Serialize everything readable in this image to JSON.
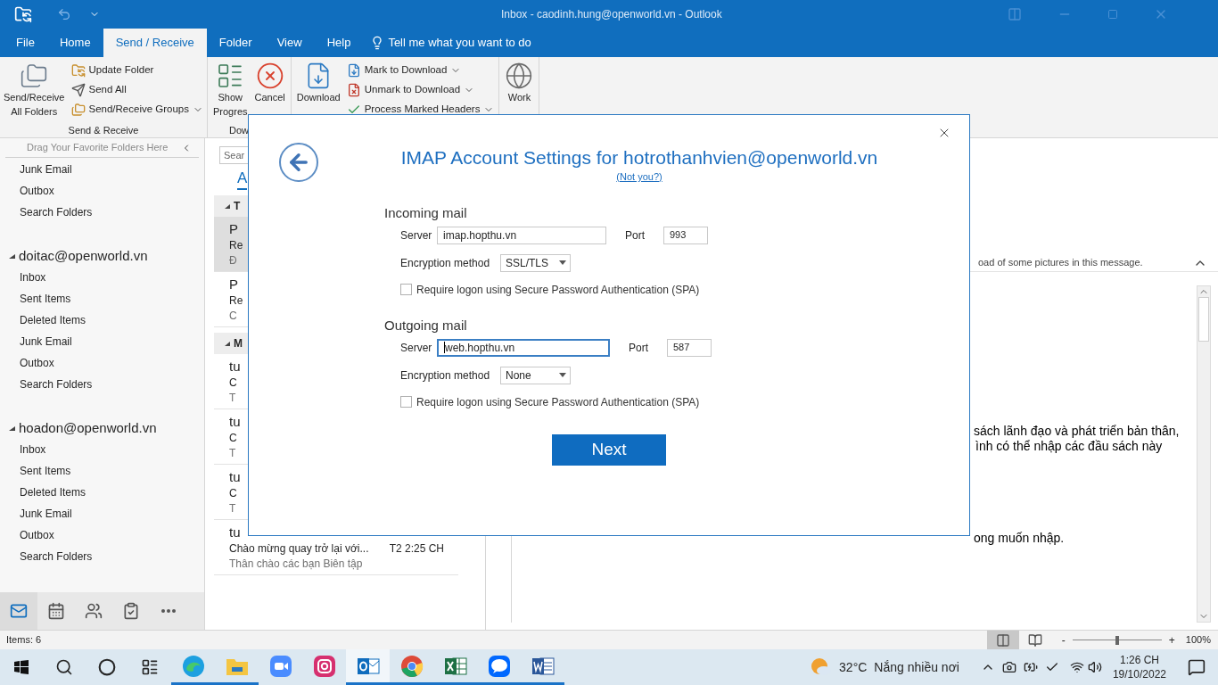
{
  "window": {
    "title": "Inbox - caodinh.hung@openworld.vn - Outlook"
  },
  "ribbon_tabs": [
    {
      "label": "File",
      "selected": false
    },
    {
      "label": "Home",
      "selected": false
    },
    {
      "label": "Send / Receive",
      "selected": true
    },
    {
      "label": "Folder",
      "selected": false
    },
    {
      "label": "View",
      "selected": false
    },
    {
      "label": "Help",
      "selected": false
    }
  ],
  "tell_me": "Tell me what you want to do",
  "ribbon_groups": [
    {
      "label": "Send & Receive",
      "large": [
        {
          "lines": [
            "Send/Receive",
            "All Folders"
          ],
          "kind": "sendreceive"
        }
      ],
      "small": [
        {
          "label": "Update Folder",
          "dropdown": false,
          "kind": "update"
        },
        {
          "label": "Send All",
          "dropdown": false,
          "kind": "sendall"
        },
        {
          "label": "Send/Receive Groups",
          "dropdown": true,
          "kind": "groups"
        }
      ]
    },
    {
      "label": "Dow",
      "large": [
        {
          "lines": [
            "Show",
            "Progres"
          ],
          "kind": "progress"
        },
        {
          "lines": [
            "Cancel"
          ],
          "kind": "cancel"
        }
      ]
    },
    {
      "large": [
        {
          "lines": [
            "Download"
          ],
          "kind": "download"
        }
      ],
      "small": [
        {
          "label": "Mark to Download",
          "dropdown": true,
          "kind": "mark"
        },
        {
          "label": "Unmark to Download",
          "dropdown": true,
          "kind": "unmark"
        },
        {
          "label": "Process Marked Headers",
          "dropdown": true,
          "kind": "process"
        }
      ]
    },
    {
      "large": [
        {
          "lines": [
            "Work"
          ],
          "kind": "offline"
        }
      ]
    }
  ],
  "folder_pane": {
    "favorites_hint": "Drag Your Favorite Folders Here",
    "top_folders": [
      "Junk Email",
      "Outbox",
      "Search Folders"
    ],
    "accounts": [
      {
        "name": "doitac@openworld.vn",
        "expanded": true,
        "folders": [
          "Inbox",
          "Sent Items",
          "Deleted Items",
          "Junk Email",
          "Outbox",
          "Search Folders"
        ]
      },
      {
        "name": "hoadon@openworld.vn",
        "expanded": true,
        "folders": [
          "Inbox",
          "Sent Items",
          "Deleted Items",
          "Junk Email",
          "Outbox",
          "Search Folders"
        ]
      }
    ],
    "nav": [
      {
        "kind": "mail",
        "selected": true
      },
      {
        "kind": "calendar",
        "selected": false
      },
      {
        "kind": "people",
        "selected": false
      },
      {
        "kind": "tasks",
        "selected": false
      },
      {
        "kind": "more",
        "selected": false
      }
    ]
  },
  "message_list": {
    "search": "Sear",
    "tab": "A",
    "groups": [
      {
        "label": "T",
        "items": [
          {
            "sender": "P",
            "subject": "Re",
            "preview": "Đ",
            "selected": true
          },
          {
            "sender": "P",
            "subject": "Re",
            "preview": "C",
            "selected": false
          }
        ]
      },
      {
        "label": "M",
        "items": [
          {
            "sender": "tu",
            "subject": "C",
            "preview": "T",
            "selected": false
          },
          {
            "sender": "tu",
            "subject": "C",
            "preview": "T",
            "selected": false
          },
          {
            "sender": "tu",
            "subject": "C",
            "preview": "T",
            "selected": false
          },
          {
            "sender": "tu",
            "subject": "Chào mừng quay trở lại với...",
            "preview": "Thân chào các bạn Biên tập",
            "time": "T2 2:25 CH",
            "selected": false
          }
        ]
      }
    ]
  },
  "reading_pane": {
    "infobar": "oad of some pictures in this message.",
    "body": [
      "sách lãnh đạo và phát triển bản thân,",
      "ình có thể nhập các đầu sách này",
      "ong muốn nhập."
    ]
  },
  "dialog": {
    "title": "IMAP Account Settings for hotrothanhvien@openworld.vn",
    "not_you": "(Not you?)",
    "sections": [
      {
        "heading": "Incoming mail",
        "server_label": "Server",
        "server": "imap.hopthu.vn",
        "focused": false,
        "port_label": "Port",
        "port": "993",
        "encryption_label": "Encryption method",
        "encryption": "SSL/TLS",
        "spa_label": "Require logon using Secure Password Authentication (SPA)",
        "spa": false
      },
      {
        "heading": "Outgoing mail",
        "server_label": "Server",
        "server": "web.hopthu.vn",
        "focused": true,
        "port_label": "Port",
        "port": "587",
        "encryption_label": "Encryption method",
        "encryption": "None",
        "spa_label": "Require logon using Secure Password Authentication (SPA)",
        "spa": false
      }
    ],
    "next": "Next"
  },
  "status_bar": {
    "items": "Items: 6",
    "views": [
      {
        "kind": "normal",
        "selected": true
      },
      {
        "kind": "reading",
        "selected": false
      }
    ],
    "zoom_minus": "-",
    "zoom_plus": "+",
    "zoom": {
      "level": 0.5
    },
    "zoom_label": "100%"
  },
  "taskbar": {
    "apps": [
      {
        "kind": "edge",
        "running": true,
        "active": false
      },
      {
        "kind": "explorer",
        "running": true,
        "active": false
      },
      {
        "kind": "zoom",
        "running": false,
        "active": false
      },
      {
        "kind": "instagram",
        "running": false,
        "active": false
      },
      {
        "kind": "outlook",
        "running": true,
        "active": true
      },
      {
        "kind": "chrome",
        "running": true,
        "active": false
      },
      {
        "kind": "excel",
        "running": true,
        "active": false
      },
      {
        "kind": "zalo",
        "running": true,
        "active": false
      },
      {
        "kind": "word",
        "running": true,
        "active": false
      }
    ],
    "temperature": "32°C",
    "weather": "Nắng nhiều nơi",
    "time": "1:26 CH",
    "date": "19/10/2022"
  }
}
